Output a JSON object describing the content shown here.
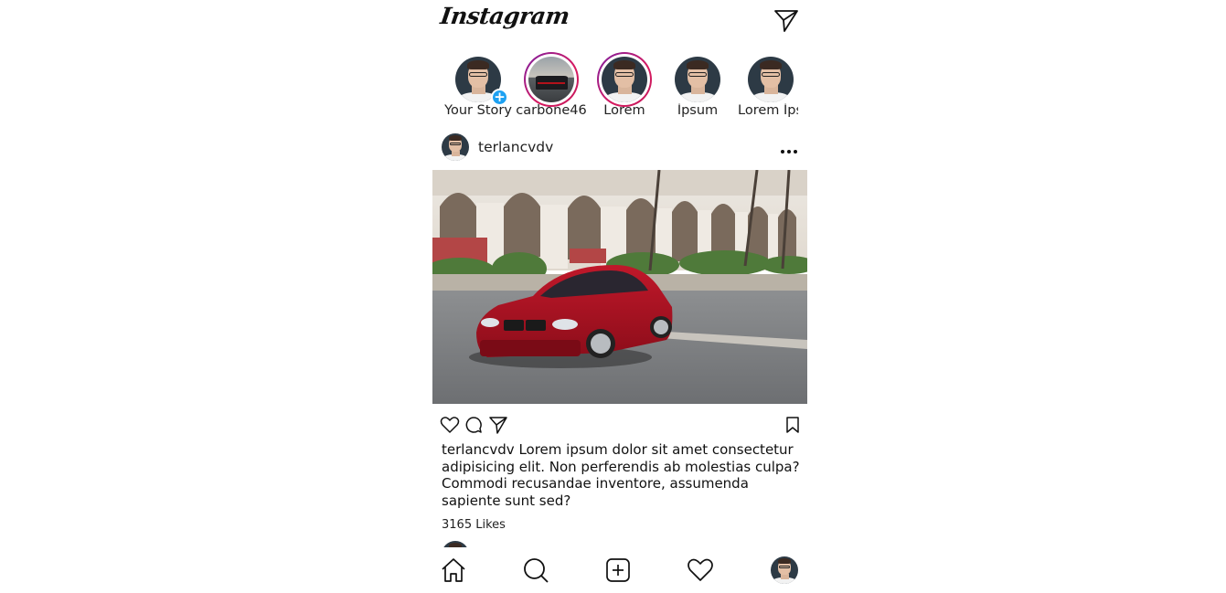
{
  "app": {
    "logo_text": "Instagram"
  },
  "header": {
    "direct_icon": "paper-plane-icon"
  },
  "stories": [
    {
      "label": "Your Story",
      "type": "own",
      "avatar": "user-face"
    },
    {
      "label": "carbone46",
      "type": "unseen",
      "avatar": "car"
    },
    {
      "label": "Lorem",
      "type": "unseen",
      "avatar": "user-face"
    },
    {
      "label": "İpsum",
      "type": "seen",
      "avatar": "user-face"
    },
    {
      "label": "Lorem İpsum",
      "type": "seen",
      "avatar": "user-face"
    }
  ],
  "post": {
    "username": "terlancvdv",
    "more_icon": "ellipsis-icon",
    "image_subject": "red-coupe-car",
    "actions": {
      "like_icon": "heart-icon",
      "comment_icon": "comment-icon",
      "share_icon": "paper-plane-icon",
      "save_icon": "bookmark-icon"
    },
    "caption_user": "terlancvdv",
    "caption_text": " Lorem ipsum dolor sit amet consectetur adipisicing elit. Non perferendis ab molestias culpa? Commodi recusandae inventore, assumenda sapiente sunt sed?",
    "likes_count": "3165",
    "likes_label": "Likes"
  },
  "bottom_nav": {
    "items": [
      "home-icon",
      "search-icon",
      "add-post-icon",
      "activity-heart-icon",
      "profile-avatar"
    ]
  },
  "colors": {
    "story_ring_start": "#7b1fa2",
    "story_ring_end": "#d81b60",
    "add_badge": "#1da1f2",
    "car": "#b3121b"
  }
}
